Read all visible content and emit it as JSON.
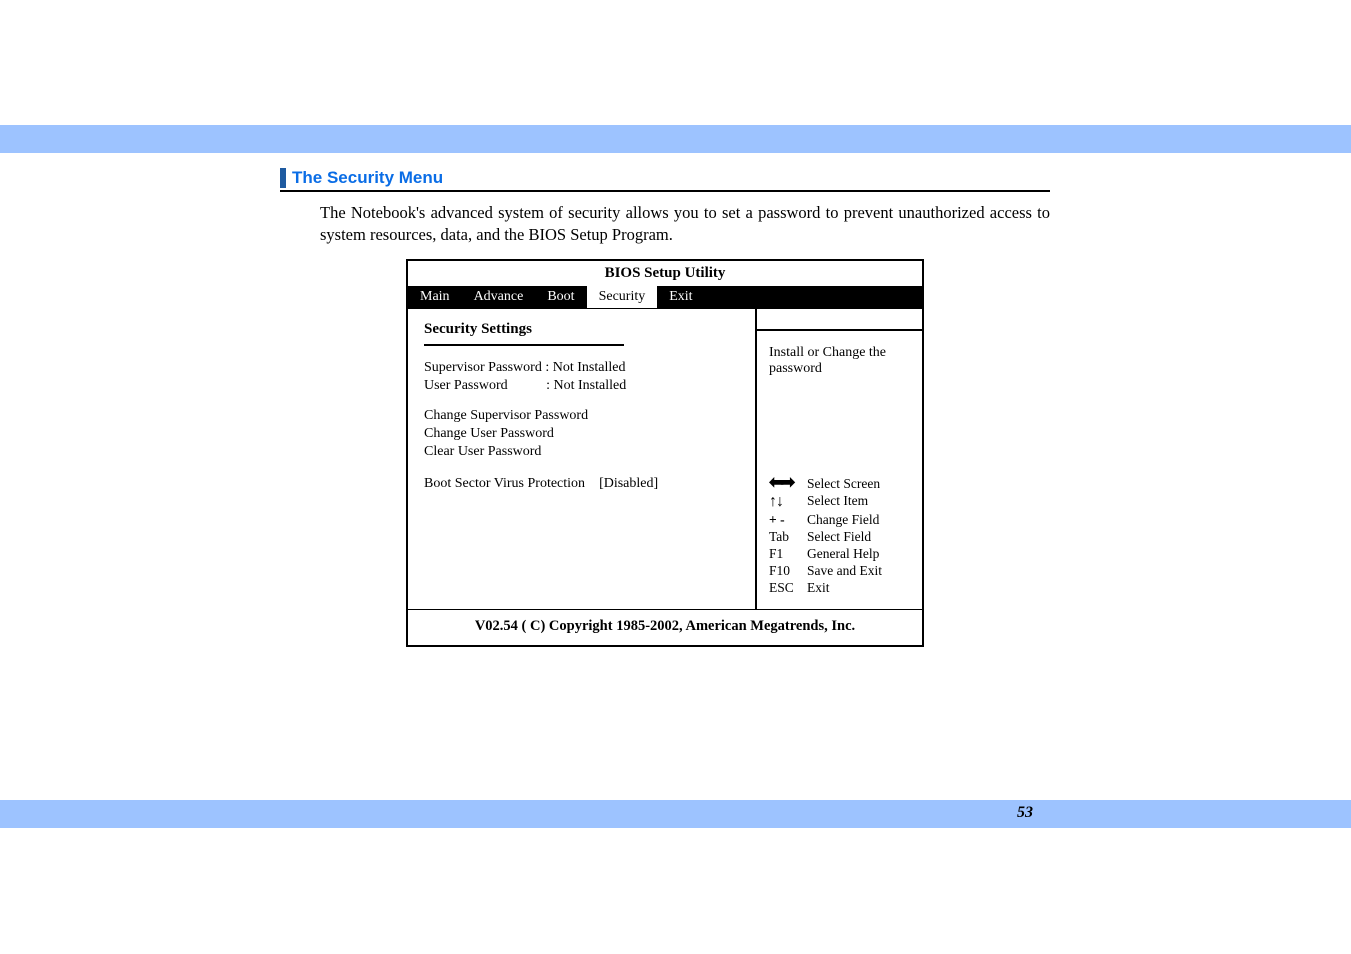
{
  "heading": "The Security Menu",
  "body": "The Notebook's advanced system of security allows you to set a password to prevent unauthorized access to system resources, data, and the BIOS Setup Program.",
  "bios": {
    "title": "BIOS Setup Utility",
    "tabs": {
      "main": "Main",
      "advance": "Advance",
      "boot": "Boot",
      "security": "Security",
      "exit": "Exit"
    },
    "section_title": "Security Settings",
    "sup_pw_label": "Supervisor Password",
    "sup_pw_val": "Not Installed",
    "user_pw_label": "User Password",
    "user_pw_val": "Not Installed",
    "change_sup": "Change Supervisor Password",
    "change_user": "Change User Password",
    "clear_user": "Clear User Password",
    "bootsec_label": "Boot Sector Virus Protection",
    "bootsec_val": "[Disabled]",
    "help_text": "Install or Change the password",
    "keys": {
      "lr": "Select Screen",
      "ud": "Select Item",
      "pm_k": "+ -",
      "pm": "Change Field",
      "tab_k": "Tab",
      "tab": "Select Field",
      "f1_k": "F1",
      "f1": "General Help",
      "f10_k": "F10",
      "f10": "Save and Exit",
      "esc_k": "ESC",
      "esc": "Exit"
    },
    "footer": "V02.54  ( C) Copyright 1985-2002, American Megatrends, Inc."
  },
  "page_number": "53"
}
